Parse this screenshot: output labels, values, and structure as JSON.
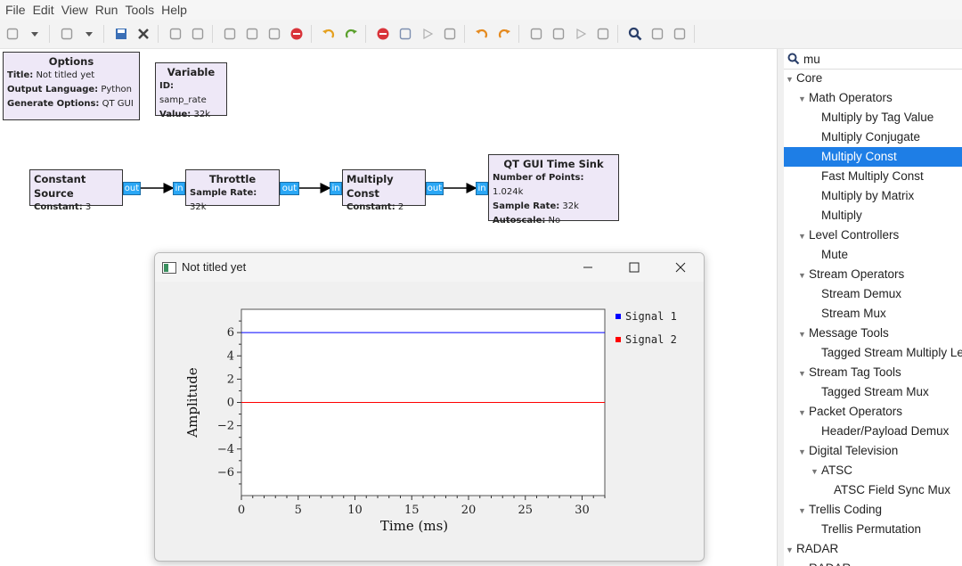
{
  "menu": [
    "File",
    "Edit",
    "View",
    "Run",
    "Tools",
    "Help"
  ],
  "toolbar_icons": [
    "new-icon",
    "dropdown-arrow-icon",
    "open-icon",
    "dropdown-arrow-icon",
    "save-icon",
    "close-icon",
    "edit-icon",
    "screenshot-icon",
    "cut-icon",
    "copy-icon",
    "paste-icon",
    "delete-icon",
    "undo-icon",
    "redo-icon",
    "stop-icon",
    "kill-icon",
    "run-icon",
    "stop-square-icon",
    "rotate-ccw-icon",
    "rotate-cw-icon",
    "zoom-in-icon",
    "zoom-out-icon",
    "forward-icon",
    "up-icon",
    "find-icon",
    "reload-icon",
    "wand-icon"
  ],
  "blocks": {
    "options": {
      "title": "Options",
      "lines": [
        [
          "Title:",
          "Not titled yet"
        ],
        [
          "Output Language:",
          "Python"
        ],
        [
          "Generate Options:",
          "QT GUI"
        ]
      ]
    },
    "variable": {
      "title": "Variable",
      "lines": [
        [
          "ID:",
          "samp_rate"
        ],
        [
          "Value:",
          "32k"
        ]
      ]
    },
    "constant_source": {
      "title": "Constant Source",
      "lines": [
        [
          "Constant:",
          "3"
        ]
      ],
      "port_out": "out"
    },
    "throttle": {
      "title": "Throttle",
      "lines": [
        [
          "Sample Rate:",
          "32k"
        ]
      ],
      "port_in": "in",
      "port_out": "out"
    },
    "multiply_const": {
      "title": "Multiply Const",
      "lines": [
        [
          "Constant:",
          "2"
        ]
      ],
      "port_in": "in",
      "port_out": "out"
    },
    "time_sink": {
      "title": "QT GUI Time Sink",
      "lines": [
        [
          "Number of Points:",
          "1.024k"
        ],
        [
          "Sample Rate:",
          "32k"
        ],
        [
          "Autoscale:",
          "No"
        ]
      ],
      "port_in": "in"
    }
  },
  "popup": {
    "title": "Not titled yet"
  },
  "chart_data": {
    "type": "line",
    "title": "",
    "xlabel": "Time (ms)",
    "ylabel": "Amplitude",
    "xlim": [
      0,
      32
    ],
    "ylim": [
      -8,
      8
    ],
    "xticks": [
      0,
      5,
      10,
      15,
      20,
      25,
      30
    ],
    "yticks": [
      -6,
      -4,
      -2,
      0,
      2,
      4,
      6
    ],
    "grid": false,
    "legend_position": "right",
    "series": [
      {
        "name": "Signal 1",
        "color": "#0000ff",
        "x": [
          0,
          32
        ],
        "y": [
          6,
          6
        ]
      },
      {
        "name": "Signal 2",
        "color": "#ff0000",
        "x": [
          0,
          32
        ],
        "y": [
          0,
          0
        ]
      }
    ]
  },
  "tree": {
    "search": "mu",
    "rows": [
      {
        "label": "Core",
        "level": 0,
        "expanded": true
      },
      {
        "label": "Math Operators",
        "level": 1,
        "expanded": true
      },
      {
        "label": "Multiply by Tag Value",
        "level": 2
      },
      {
        "label": "Multiply Conjugate",
        "level": 2
      },
      {
        "label": "Multiply Const",
        "level": 2,
        "selected": true
      },
      {
        "label": "Fast Multiply Const",
        "level": 2
      },
      {
        "label": "Multiply by Matrix",
        "level": 2
      },
      {
        "label": "Multiply",
        "level": 2
      },
      {
        "label": "Level Controllers",
        "level": 1,
        "expanded": true
      },
      {
        "label": "Mute",
        "level": 2
      },
      {
        "label": "Stream Operators",
        "level": 1,
        "expanded": true
      },
      {
        "label": "Stream Demux",
        "level": 2
      },
      {
        "label": "Stream Mux",
        "level": 2
      },
      {
        "label": "Message Tools",
        "level": 1,
        "expanded": true
      },
      {
        "label": "Tagged Stream Multiply Length",
        "level": 2
      },
      {
        "label": "Stream Tag Tools",
        "level": 1,
        "expanded": true
      },
      {
        "label": "Tagged Stream Mux",
        "level": 2
      },
      {
        "label": "Packet Operators",
        "level": 1,
        "expanded": true
      },
      {
        "label": "Header/Payload Demux",
        "level": 2
      },
      {
        "label": "Digital Television",
        "level": 1,
        "expanded": true
      },
      {
        "label": "ATSC",
        "level": 2,
        "expanded": true
      },
      {
        "label": "ATSC Field Sync Mux",
        "level": 3
      },
      {
        "label": "Trellis Coding",
        "level": 1,
        "expanded": true
      },
      {
        "label": "Trellis Permutation",
        "level": 2
      },
      {
        "label": "RADAR",
        "level": 0,
        "expanded": true
      },
      {
        "label": "RADAR",
        "level": 1,
        "expanded": true
      }
    ]
  }
}
